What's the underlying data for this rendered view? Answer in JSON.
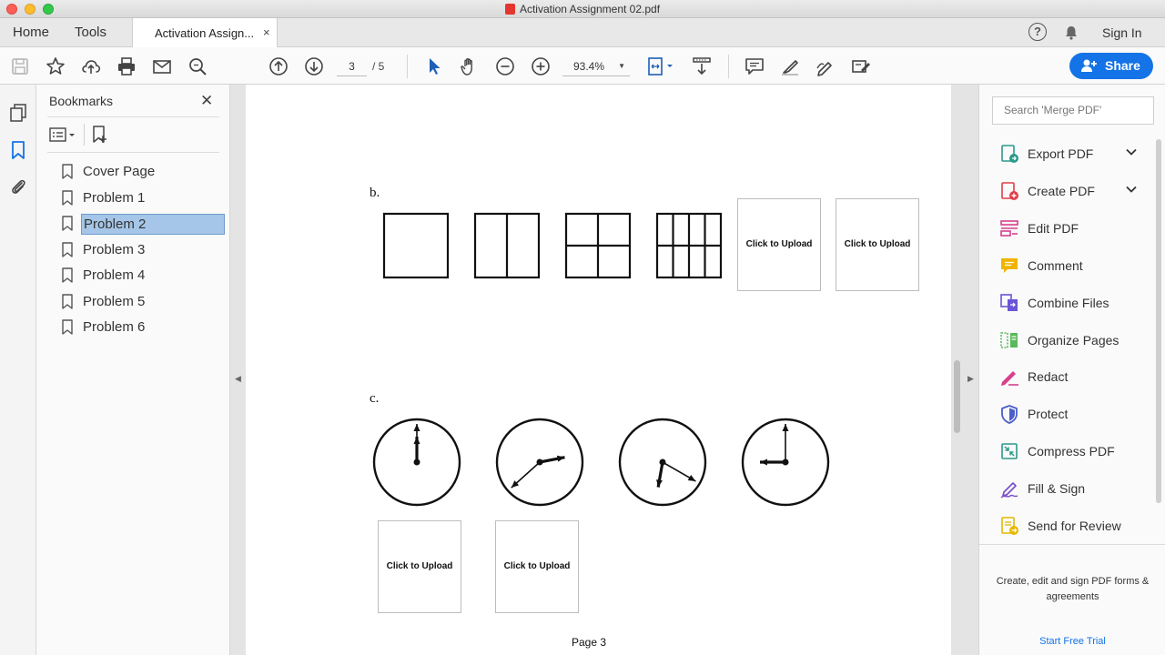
{
  "window": {
    "title": "Activation Assignment 02.pdf"
  },
  "tabs": {
    "home": "Home",
    "tools": "Tools",
    "document": "Activation Assign...",
    "close": "×"
  },
  "header": {
    "help": "?",
    "signin": "Sign In"
  },
  "toolbar": {
    "page_current": "3",
    "page_total": "/ 5",
    "zoom": "93.4%",
    "share": "Share"
  },
  "bookmarks": {
    "title": "Bookmarks",
    "close": "✕",
    "items": [
      {
        "label": "Cover Page"
      },
      {
        "label": "Problem 1"
      },
      {
        "label": "Problem 2",
        "selected": true
      },
      {
        "label": "Problem 3"
      },
      {
        "label": "Problem 4"
      },
      {
        "label": "Problem 5"
      },
      {
        "label": "Problem 6"
      }
    ]
  },
  "document": {
    "section_b": "b.",
    "section_c": "c.",
    "upload_label": "Click to Upload",
    "footer": "Page 3",
    "clocks": [
      {
        "hour": 12,
        "minute": 0
      },
      {
        "hour": 2,
        "minute": 38
      },
      {
        "hour": 6,
        "minute": 20
      },
      {
        "hour": 9,
        "minute": 0
      }
    ]
  },
  "tools_panel": {
    "search_placeholder": "Search 'Merge PDF'",
    "items": [
      {
        "label": "Export PDF",
        "icon": "export-pdf-icon",
        "color": "#2b9a8a",
        "expandable": true
      },
      {
        "label": "Create PDF",
        "icon": "create-pdf-icon",
        "color": "#e0404a",
        "expandable": true
      },
      {
        "label": "Edit PDF",
        "icon": "edit-pdf-icon",
        "color": "#d6408c"
      },
      {
        "label": "Comment",
        "icon": "comment-icon",
        "color": "#f0b400"
      },
      {
        "label": "Combine Files",
        "icon": "combine-files-icon",
        "color": "#6a55d6"
      },
      {
        "label": "Organize Pages",
        "icon": "organize-pages-icon",
        "color": "#5cb85c"
      },
      {
        "label": "Redact",
        "icon": "redact-icon",
        "color": "#d6408c"
      },
      {
        "label": "Protect",
        "icon": "protect-icon",
        "color": "#4a5fc8"
      },
      {
        "label": "Compress PDF",
        "icon": "compress-pdf-icon",
        "color": "#2b9a8a"
      },
      {
        "label": "Fill & Sign",
        "icon": "fill-sign-icon",
        "color": "#7a4fc8"
      },
      {
        "label": "Send for Review",
        "icon": "send-review-icon",
        "color": "#e8b800"
      }
    ],
    "promo": "Create, edit and sign PDF forms & agreements",
    "trial": "Start Free Trial"
  },
  "colors": {
    "accent": "#1473e6",
    "selection": "#a5c6e8"
  }
}
